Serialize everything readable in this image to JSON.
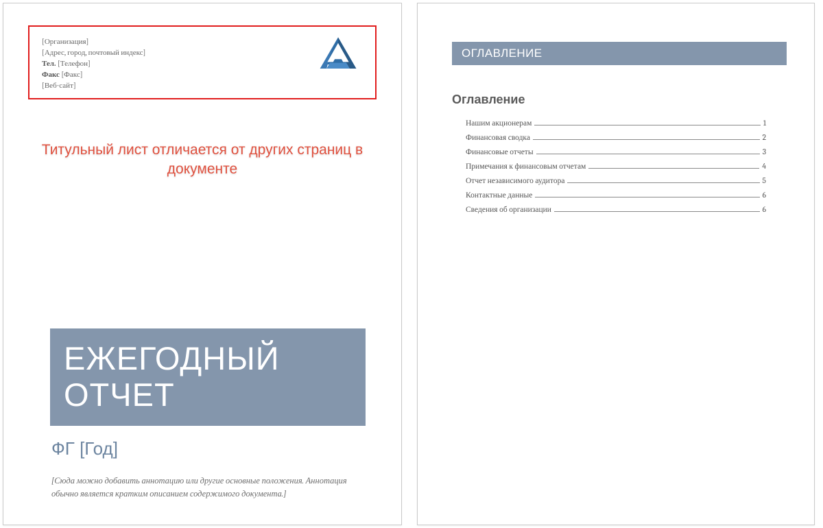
{
  "header": {
    "org": "[Организация]",
    "addr": "[Адрес, город, почтовый индекс]",
    "tel_label": "Тел.",
    "tel_value": "[Телефон]",
    "fax_label": "Факс",
    "fax_value": "[Факс]",
    "web": "[Веб-сайт]"
  },
  "callout": "Титульный лист отличается от других страниц в документе",
  "title": "ЕЖЕГОДНЫЙ ОТЧЕТ",
  "subtitle": "ФГ [Год]",
  "abstract": "[Сюда можно добавить аннотацию или другие основные положения. Аннотация обычно является кратким описанием содержимого документа.]",
  "section_band": "ОГЛАВЛЕНИЕ",
  "toc_heading": "Оглавление",
  "toc": [
    {
      "label": "Нашим акционерам",
      "page": "1"
    },
    {
      "label": "Финансовая сводка",
      "page": "2"
    },
    {
      "label": "Финансовые отчеты",
      "page": "3"
    },
    {
      "label": "Примечания к финансовым отчетам",
      "page": "4"
    },
    {
      "label": "Отчет независимого аудитора",
      "page": "5"
    },
    {
      "label": "Контактные данные",
      "page": "6"
    },
    {
      "label": "Сведения об организации",
      "page": "6"
    }
  ]
}
